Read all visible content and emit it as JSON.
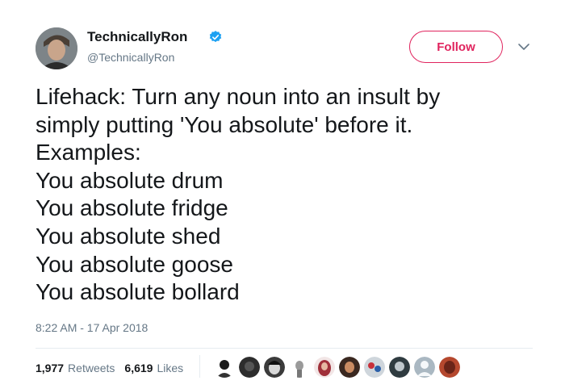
{
  "author": {
    "name": "TechnicallyRon",
    "handle": "@TechnicallyRon",
    "verified_icon": "verified-badge-icon",
    "verified_color": "#1da1f2"
  },
  "follow_button": {
    "label": "Follow",
    "color": "#e0245e"
  },
  "tweet_lines": [
    "Lifehack: Turn any noun into an insult by",
    "simply putting 'You absolute' before it.",
    "Examples:",
    "You absolute drum",
    "You absolute fridge",
    "You absolute shed",
    "You absolute goose",
    "You absolute bollard"
  ],
  "timestamp": "8:22 AM - 17 Apr 2018",
  "stats": {
    "retweets_count": "1,977",
    "retweets_label": "Retweets",
    "likes_count": "6,619",
    "likes_label": "Likes"
  },
  "colors": {
    "text": "#14171a",
    "secondary": "#657786",
    "divider": "#e6ecf0"
  }
}
